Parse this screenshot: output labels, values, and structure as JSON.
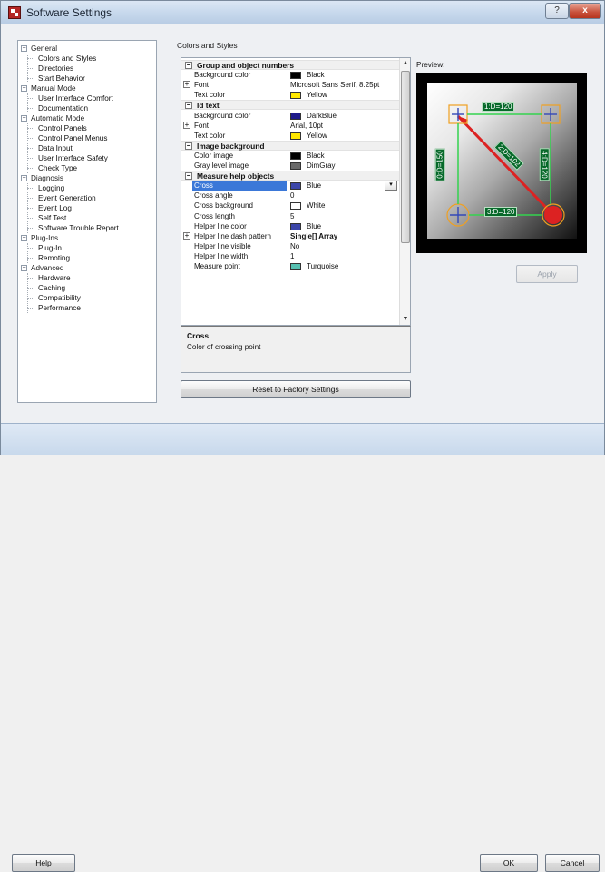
{
  "window": {
    "title": "Software Settings",
    "help_button": "?",
    "close_button": "x"
  },
  "nav": {
    "items": [
      {
        "label": "General",
        "level": 0,
        "toggle": "−"
      },
      {
        "label": "Colors and Styles",
        "level": 1
      },
      {
        "label": "Directories",
        "level": 1
      },
      {
        "label": "Start Behavior",
        "level": 1
      },
      {
        "label": "Manual Mode",
        "level": 0,
        "toggle": "−"
      },
      {
        "label": "User Interface Comfort",
        "level": 1
      },
      {
        "label": "Documentation",
        "level": 1
      },
      {
        "label": "Automatic Mode",
        "level": 0,
        "toggle": "−"
      },
      {
        "label": "Control Panels",
        "level": 1
      },
      {
        "label": "Control Panel Menus",
        "level": 1
      },
      {
        "label": "Data Input",
        "level": 1
      },
      {
        "label": "User Interface Safety",
        "level": 1
      },
      {
        "label": "Check Type",
        "level": 1
      },
      {
        "label": "Diagnosis",
        "level": 0,
        "toggle": "−"
      },
      {
        "label": "Logging",
        "level": 1
      },
      {
        "label": "Event Generation",
        "level": 1
      },
      {
        "label": "Event Log",
        "level": 1
      },
      {
        "label": "Self Test",
        "level": 1
      },
      {
        "label": "Software Trouble Report",
        "level": 1
      },
      {
        "label": "Plug-Ins",
        "level": 0,
        "toggle": "−"
      },
      {
        "label": "Plug-In",
        "level": 1
      },
      {
        "label": "Remoting",
        "level": 1
      },
      {
        "label": "Advanced",
        "level": 0,
        "toggle": "−"
      },
      {
        "label": "Hardware",
        "level": 1
      },
      {
        "label": "Caching",
        "level": 1
      },
      {
        "label": "Compatibility",
        "level": 1
      },
      {
        "label": "Performance",
        "level": 1
      }
    ]
  },
  "section": {
    "title": "Colors and Styles"
  },
  "grid": {
    "rows": [
      {
        "type": "category",
        "label": "Group and object numbers"
      },
      {
        "type": "prop",
        "name": "Background color",
        "swatch": "#000000",
        "value": "Black"
      },
      {
        "type": "prop",
        "name": "Font",
        "value": "Microsoft Sans Serif, 8.25pt",
        "expandable": true
      },
      {
        "type": "prop",
        "name": "Text color",
        "swatch": "#ffe800",
        "value": "Yellow"
      },
      {
        "type": "category",
        "label": "Id text"
      },
      {
        "type": "prop",
        "name": "Background color",
        "swatch": "#1e1a8a",
        "value": "DarkBlue"
      },
      {
        "type": "prop",
        "name": "Font",
        "value": "Arial, 10pt",
        "expandable": true
      },
      {
        "type": "prop",
        "name": "Text color",
        "swatch": "#ffe800",
        "value": "Yellow"
      },
      {
        "type": "category",
        "label": "Image background"
      },
      {
        "type": "prop",
        "name": "Color image",
        "swatch": "#000000",
        "value": "Black"
      },
      {
        "type": "prop",
        "name": "Gray level image",
        "swatch": "#696969",
        "value": "DimGray"
      },
      {
        "type": "category",
        "label": "Measure help objects"
      },
      {
        "type": "prop",
        "name": "Cross",
        "swatch": "#3b45a8",
        "value": "Blue",
        "selected": true
      },
      {
        "type": "prop",
        "name": "Cross angle",
        "value": "0"
      },
      {
        "type": "prop",
        "name": "Cross background",
        "swatch": "#ffffff",
        "value": "White"
      },
      {
        "type": "prop",
        "name": "Cross length",
        "value": "5"
      },
      {
        "type": "prop",
        "name": "Helper line color",
        "swatch": "#3b45a8",
        "value": "Blue"
      },
      {
        "type": "prop",
        "name": "Helper line dash pattern",
        "value": "Single[] Array",
        "expandable": true,
        "bold": true
      },
      {
        "type": "prop",
        "name": "Helper line visible",
        "value": "No"
      },
      {
        "type": "prop",
        "name": "Helper line width",
        "value": "1"
      },
      {
        "type": "prop",
        "name": "Measure point",
        "swatch": "#56c0b1",
        "value": "Turquoise"
      }
    ]
  },
  "description": {
    "title": "Cross",
    "text": "Color of crossing point"
  },
  "buttons": {
    "reset": "Reset to Factory Settings",
    "apply": "Apply",
    "help": "Help",
    "ok": "OK",
    "cancel": "Cancel"
  },
  "preview": {
    "label": "Preview:",
    "labels": [
      "1:D=120",
      "0:D=150",
      "2:D=102",
      "4:D=120",
      "3:D=120"
    ]
  }
}
